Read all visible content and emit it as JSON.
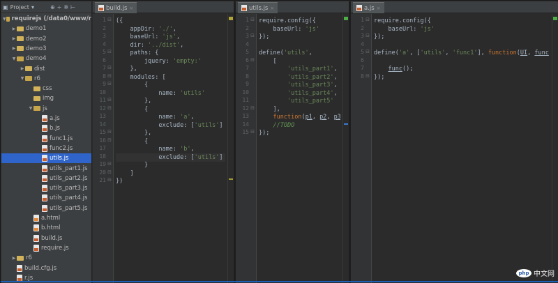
{
  "project": {
    "header": "Project",
    "tree": [
      {
        "label": "requirejs (/data0/www/r",
        "depth": 0,
        "type": "folder",
        "open": true,
        "bold": true
      },
      {
        "label": "demo1",
        "depth": 1,
        "type": "folder",
        "open": false
      },
      {
        "label": "demo2",
        "depth": 1,
        "type": "folder",
        "open": false
      },
      {
        "label": "demo3",
        "depth": 1,
        "type": "folder",
        "open": false
      },
      {
        "label": "demo4",
        "depth": 1,
        "type": "folder",
        "open": true
      },
      {
        "label": "dist",
        "depth": 2,
        "type": "folder",
        "open": false
      },
      {
        "label": "r6",
        "depth": 2,
        "type": "folder",
        "open": true
      },
      {
        "label": "css",
        "depth": 3,
        "type": "folder",
        "open": false,
        "noarrow": true
      },
      {
        "label": "img",
        "depth": 3,
        "type": "folder",
        "open": false,
        "noarrow": true
      },
      {
        "label": "js",
        "depth": 3,
        "type": "folder",
        "open": true
      },
      {
        "label": "a.js",
        "depth": 4,
        "type": "js"
      },
      {
        "label": "b.js",
        "depth": 4,
        "type": "js"
      },
      {
        "label": "func1.js",
        "depth": 4,
        "type": "js"
      },
      {
        "label": "func2.js",
        "depth": 4,
        "type": "js"
      },
      {
        "label": "utils.js",
        "depth": 4,
        "type": "js",
        "selected": true
      },
      {
        "label": "utils_part1.js",
        "depth": 4,
        "type": "js"
      },
      {
        "label": "utils_part2.js",
        "depth": 4,
        "type": "js"
      },
      {
        "label": "utils_part3.js",
        "depth": 4,
        "type": "js"
      },
      {
        "label": "utils_part4.js",
        "depth": 4,
        "type": "js"
      },
      {
        "label": "utils_part5.js",
        "depth": 4,
        "type": "js"
      },
      {
        "label": "a.html",
        "depth": 3,
        "type": "html"
      },
      {
        "label": "b.html",
        "depth": 3,
        "type": "html"
      },
      {
        "label": "build.js",
        "depth": 3,
        "type": "js"
      },
      {
        "label": "require.js",
        "depth": 3,
        "type": "js"
      },
      {
        "label": "r6",
        "depth": 1,
        "type": "folder",
        "open": false
      },
      {
        "label": "build.cfg.js",
        "depth": 1,
        "type": "js"
      },
      {
        "label": "r.js",
        "depth": 1,
        "type": "js"
      }
    ]
  },
  "editors": [
    {
      "tab": "build.js",
      "highlight_line": 18,
      "lines": [
        [
          [
            "({",
            "p"
          ]
        ],
        [
          [
            "    appDir: ",
            "p"
          ],
          [
            "'./'",
            "s"
          ],
          [
            ",",
            "p"
          ]
        ],
        [
          [
            "    baseUrl: ",
            "p"
          ],
          [
            "'js'",
            "s"
          ],
          [
            ",",
            "p"
          ]
        ],
        [
          [
            "    dir: ",
            "p"
          ],
          [
            "'../dist'",
            "s"
          ],
          [
            ",",
            "p"
          ]
        ],
        [
          [
            "    paths: {",
            "p"
          ]
        ],
        [
          [
            "        jquery: ",
            "p"
          ],
          [
            "'empty:'",
            "s"
          ]
        ],
        [
          [
            "    },",
            "p"
          ]
        ],
        [
          [
            "    modules: [",
            "p"
          ]
        ],
        [
          [
            "        {",
            "p"
          ]
        ],
        [
          [
            "            name: ",
            "p"
          ],
          [
            "'utils'",
            "s"
          ]
        ],
        [
          [
            "        },",
            "p"
          ]
        ],
        [
          [
            "        {",
            "p"
          ]
        ],
        [
          [
            "            name: ",
            "p"
          ],
          [
            "'a'",
            "s"
          ],
          [
            ",",
            "p"
          ]
        ],
        [
          [
            "            exclude: [",
            "p"
          ],
          [
            "'utils'",
            "s"
          ],
          [
            "]",
            "p"
          ]
        ],
        [
          [
            "        },",
            "p"
          ]
        ],
        [
          [
            "        {",
            "p"
          ]
        ],
        [
          [
            "            name: ",
            "p"
          ],
          [
            "'b'",
            "s"
          ],
          [
            ",",
            "p"
          ]
        ],
        [
          [
            "            exclude: [",
            "p"
          ],
          [
            "'utils'",
            "s"
          ],
          [
            "]",
            "p"
          ]
        ],
        [
          [
            "        }",
            "p"
          ]
        ],
        [
          [
            "    ]",
            "p"
          ]
        ],
        [
          [
            "})",
            "p"
          ]
        ]
      ]
    },
    {
      "tab": "utils.js",
      "highlight_line": 0,
      "lines": [
        [
          [
            "require.config({",
            "p"
          ]
        ],
        [
          [
            "    baseUrl: ",
            "p"
          ],
          [
            "'js'",
            "s"
          ]
        ],
        [
          [
            "});",
            "p"
          ]
        ],
        [
          [
            "",
            "p"
          ]
        ],
        [
          [
            "define(",
            "p"
          ],
          [
            "'utils'",
            "s"
          ],
          [
            ",",
            "p"
          ]
        ],
        [
          [
            "    [",
            "p"
          ]
        ],
        [
          [
            "        ",
            "p"
          ],
          [
            "'utils_part1'",
            "s"
          ],
          [
            ",",
            "p"
          ]
        ],
        [
          [
            "        ",
            "p"
          ],
          [
            "'utils_part2'",
            "s"
          ],
          [
            ",",
            "p"
          ]
        ],
        [
          [
            "        ",
            "p"
          ],
          [
            "'utils_part3'",
            "s"
          ],
          [
            ",",
            "p"
          ]
        ],
        [
          [
            "        ",
            "p"
          ],
          [
            "'utils_part4'",
            "s"
          ],
          [
            ",",
            "p"
          ]
        ],
        [
          [
            "        ",
            "p"
          ],
          [
            "'utils_part5'",
            "s"
          ]
        ],
        [
          [
            "    ],",
            "p"
          ]
        ],
        [
          [
            "    ",
            "p"
          ],
          [
            "function",
            "k"
          ],
          [
            "(",
            "p"
          ],
          [
            "p1",
            "u"
          ],
          [
            ", ",
            "p"
          ],
          [
            "p2",
            "u"
          ],
          [
            ", ",
            "p"
          ],
          [
            "p3",
            "u"
          ]
        ],
        [
          [
            "    ",
            "p"
          ],
          [
            "//TODO",
            "c"
          ]
        ],
        [
          [
            "});",
            "p"
          ]
        ]
      ]
    },
    {
      "tab": "a.js",
      "highlight_line": 0,
      "lines": [
        [
          [
            "require.config({",
            "p"
          ]
        ],
        [
          [
            "    baseUrl: ",
            "p"
          ],
          [
            "'js'",
            "s"
          ]
        ],
        [
          [
            "});",
            "p"
          ]
        ],
        [
          [
            "",
            "p"
          ]
        ],
        [
          [
            "define(",
            "p"
          ],
          [
            "'a'",
            "s"
          ],
          [
            ", [",
            "p"
          ],
          [
            "'utils'",
            "s"
          ],
          [
            ", ",
            "p"
          ],
          [
            "'func1'",
            "s"
          ],
          [
            "], ",
            "p"
          ],
          [
            "function",
            "k"
          ],
          [
            "(",
            "p"
          ],
          [
            "UI",
            "u"
          ],
          [
            ", ",
            "p"
          ],
          [
            "func",
            "u"
          ],
          [
            "){",
            "p"
          ]
        ],
        [
          [
            "",
            "p"
          ]
        ],
        [
          [
            "    ",
            "p"
          ],
          [
            "func",
            "u"
          ],
          [
            "();",
            "p"
          ]
        ],
        [
          [
            "});",
            "p"
          ]
        ]
      ]
    }
  ],
  "watermark": {
    "logo": "php",
    "text": "中文网"
  },
  "colors": {
    "string": "#6a8759",
    "keyword": "#cc7832",
    "comment": "#629755",
    "selection": "#2f65ca"
  }
}
